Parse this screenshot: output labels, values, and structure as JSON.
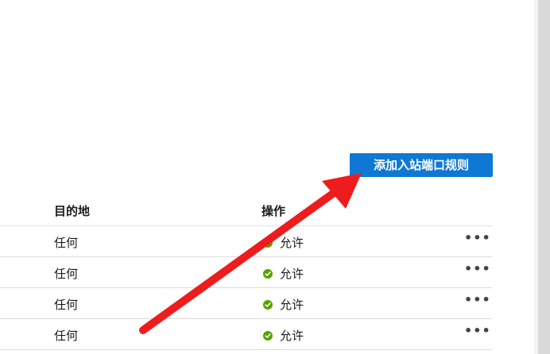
{
  "toolbar": {
    "add_inbound_rule_label": "添加入站端口规则"
  },
  "table": {
    "columns": {
      "destination": "目的地",
      "action": "操作"
    },
    "rows": [
      {
        "destination": "任何",
        "action": "允许",
        "more": "•••"
      },
      {
        "destination": "任何",
        "action": "允许",
        "more": "•••"
      },
      {
        "destination": "任何",
        "action": "允许",
        "more": "•••"
      },
      {
        "destination": "任何",
        "action": "允许",
        "more": "•••"
      }
    ]
  },
  "colors": {
    "accent": "#0f78d4",
    "allow": "#57a300",
    "annotation_arrow": "#ee1c1c"
  },
  "icons": {
    "allow": "check-circle-icon",
    "more": "more-horizontal-icon"
  }
}
